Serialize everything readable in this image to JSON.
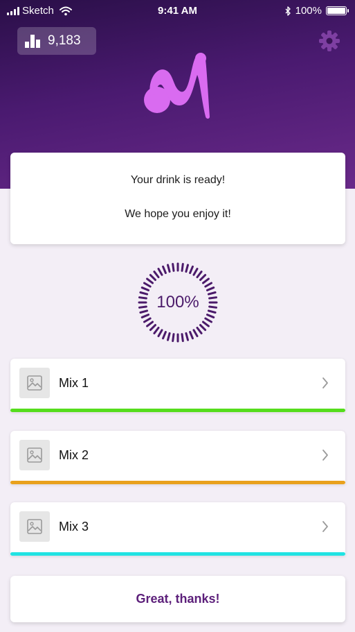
{
  "status_bar": {
    "carrier": "Sketch",
    "time": "9:41 AM",
    "battery": "100%",
    "battery_level": 1.0
  },
  "header": {
    "score": "9,183",
    "score_icon": "bar-chart-icon",
    "settings_icon": "gear-icon",
    "logo": "app-logo",
    "colors": {
      "gradient_top": "#2a0f48",
      "gradient_bottom": "#6a2a8a",
      "logo": "#d96bf0"
    }
  },
  "ready_card": {
    "line1": "Your drink is ready!",
    "line2": "We hope you enjoy it!"
  },
  "progress": {
    "label": "100%",
    "value": 1.0,
    "color": "#4b1a6a"
  },
  "mixes": [
    {
      "label": "Mix 1",
      "icon": "image-placeholder-icon",
      "accent": "#55dd1c"
    },
    {
      "label": "Mix 2",
      "icon": "image-placeholder-icon",
      "accent": "#e9a11d"
    },
    {
      "label": "Mix 3",
      "icon": "image-placeholder-icon",
      "accent": "#21e3e3"
    }
  ],
  "actions": {
    "thanks_label": "Great, thanks!",
    "thanks_color": "#5c1f7a"
  }
}
